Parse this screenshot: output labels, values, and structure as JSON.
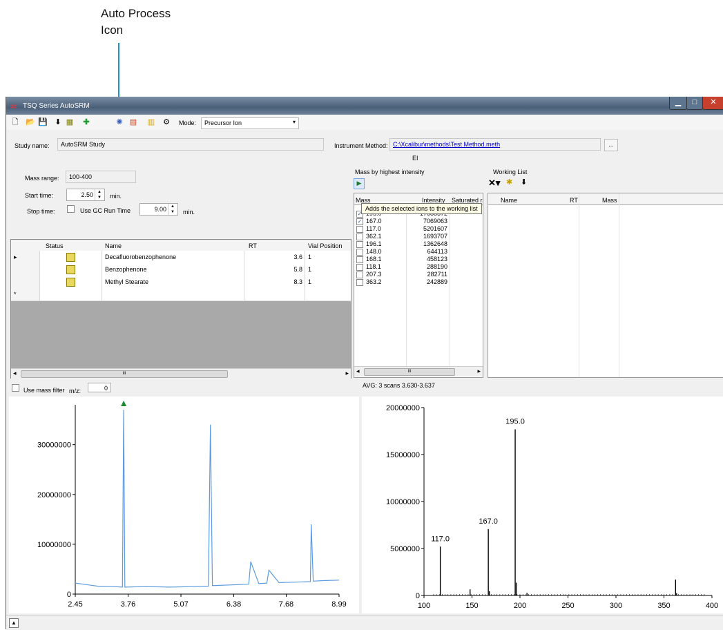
{
  "callout": {
    "line1": "Auto Process",
    "line2": "Icon"
  },
  "window": {
    "title": "TSQ Series AutoSRM"
  },
  "toolbar": {
    "mode_label": "Mode:",
    "mode_value": "Precursor Ion",
    "icons": [
      "new-icon",
      "open-icon",
      "save-icon",
      "export-icon",
      "chromatogram-icon",
      "add-icon",
      "auto-process-icon",
      "process-options-icon",
      "folder-icon",
      "settings-icon"
    ]
  },
  "study": {
    "name_label": "Study name:",
    "name_value": "AutoSRM Study"
  },
  "instrument": {
    "label": "Instrument Method:",
    "path": "C:\\Xcalibur\\methods\\Test Method.meth",
    "browse": "...",
    "ionization": "EI"
  },
  "params": {
    "mass_range_label": "Mass range:",
    "mass_range_value": "100-400",
    "start_label": "Start time:",
    "start_value": "2.50",
    "start_unit": "min.",
    "stop_label": "Stop time:",
    "use_gc_label": "Use GC Run Time",
    "stop_value": "9.00",
    "stop_unit": "min."
  },
  "sample_table": {
    "headers": [
      "Status",
      "Name",
      "RT",
      "Vial Position"
    ],
    "rows": [
      {
        "name": "Decafluorobenzophenone",
        "rt": "3.6",
        "vial": "1"
      },
      {
        "name": "Benzophenone",
        "rt": "5.8",
        "vial": "1"
      },
      {
        "name": "Methyl Stearate",
        "rt": "8.3",
        "vial": "1"
      }
    ],
    "new_row_marker": "*",
    "current_row_marker": "▸",
    "scroll_thumb": "III"
  },
  "mass_panel": {
    "title": "Mass by highest intensity",
    "headers": [
      "Mass",
      "Intensity",
      "Saturated r"
    ],
    "tooltip": "Adds the selected ions to the working list",
    "rows": [
      {
        "mass": "195.0",
        "intensity": "17688372",
        "checked": true
      },
      {
        "mass": "167.0",
        "intensity": "7069063",
        "checked": true
      },
      {
        "mass": "117.0",
        "intensity": "5201607",
        "checked": false
      },
      {
        "mass": "362.1",
        "intensity": "1693707",
        "checked": false
      },
      {
        "mass": "196.1",
        "intensity": "1362648",
        "checked": false
      },
      {
        "mass": "148.0",
        "intensity": "644113",
        "checked": false
      },
      {
        "mass": "168.1",
        "intensity": "458123",
        "checked": false
      },
      {
        "mass": "118.1",
        "intensity": "288190",
        "checked": false
      },
      {
        "mass": "207.3",
        "intensity": "282711",
        "checked": false
      },
      {
        "mass": "363.2",
        "intensity": "242889",
        "checked": false
      }
    ],
    "scroll_thumb": "III",
    "avg_text": "AVG: 3 scans 3.630-3.637"
  },
  "working_list": {
    "title": "Working List",
    "headers": [
      "Name",
      "RT",
      "Mass"
    ]
  },
  "mass_filter": {
    "label": "Use mass filter",
    "mz_label": "m/z:",
    "mz_value": "0"
  },
  "chromatogram": {
    "y_ticks": [
      "30000000",
      "20000000",
      "10000000",
      "0"
    ],
    "x_ticks": [
      "2.45",
      "3.76",
      "5.07",
      "6.38",
      "7.68",
      "8.99"
    ]
  },
  "chart_data": {
    "type": "line",
    "x": [
      2.45,
      3.0,
      3.4,
      3.62,
      3.65,
      3.68,
      4.2,
      4.8,
      5.3,
      5.75,
      5.8,
      5.85,
      6.5,
      6.75,
      6.8,
      7.0,
      7.2,
      7.25,
      7.5,
      7.9,
      8.28,
      8.3,
      8.35,
      8.6,
      8.99
    ],
    "y": [
      2200000,
      1600000,
      1500000,
      1400000,
      37000000,
      1400000,
      1500000,
      1400000,
      1500000,
      1600000,
      34000000,
      1700000,
      1900000,
      2000000,
      6500000,
      2100000,
      2200000,
      4800000,
      2300000,
      2400000,
      2500000,
      14000000,
      2600000,
      2700000,
      2800000
    ],
    "xlim": [
      2.45,
      8.99
    ],
    "ylim": [
      0,
      38000000
    ]
  },
  "spectrum": {
    "type": "bar",
    "x": [
      117.0,
      148.0,
      167.0,
      168.1,
      195.0,
      196.1,
      207.3,
      362.1,
      363.2
    ],
    "values": [
      5201607,
      644113,
      7069063,
      458123,
      17688372,
      1362648,
      282711,
      1693707,
      242889
    ],
    "labels": {
      "117.0": "117.0",
      "167.0": "167.0",
      "195.0": "195.0"
    },
    "y_ticks": [
      "20000000",
      "15000000",
      "10000000",
      "5000000",
      "0"
    ],
    "x_ticks": [
      "100",
      "150",
      "200",
      "250",
      "300",
      "350",
      "400"
    ],
    "xlim": [
      100,
      400
    ],
    "ylim": [
      0,
      20000000
    ]
  }
}
